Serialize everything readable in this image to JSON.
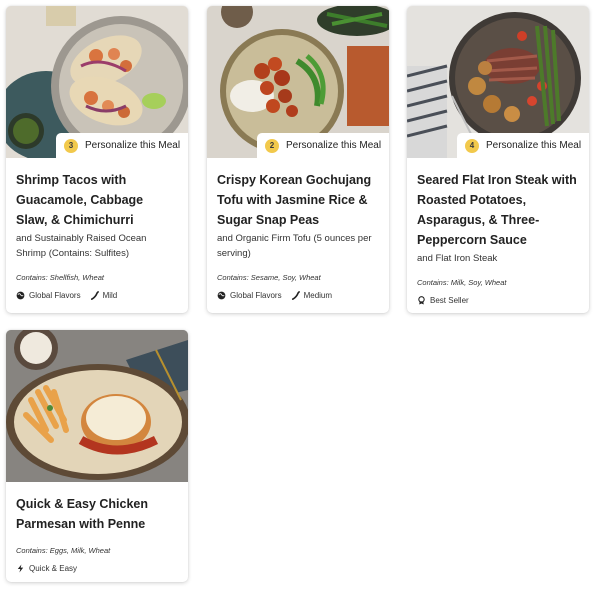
{
  "personalize_label": "Personalize this Meal",
  "cards": [
    {
      "badge": "3",
      "title": "Shrimp Tacos with Guacamole, Cabbage Slaw, & Chimichurri",
      "subtitle": "and Sustainably Raised Ocean Shrimp (Contains: Sulfites)",
      "contains": "Contains: Shellfish, Wheat",
      "tags": [
        {
          "icon": "globe-icon",
          "label": "Global Flavors"
        },
        {
          "icon": "chili-pepper-icon",
          "label": "Mild"
        }
      ]
    },
    {
      "badge": "2",
      "title": "Crispy Korean Gochujang Tofu with Jasmine Rice & Sugar Snap Peas",
      "subtitle": "and Organic Firm Tofu (5 ounces per serving)",
      "contains": "Contains: Sesame, Soy, Wheat",
      "tags": [
        {
          "icon": "globe-icon",
          "label": "Global Flavors"
        },
        {
          "icon": "chili-pepper-icon",
          "label": "Medium"
        }
      ]
    },
    {
      "badge": "4",
      "title": "Seared Flat Iron Steak with Roasted Potatoes, Asparagus, & Three-Peppercorn Sauce",
      "subtitle": "and Flat Iron Steak",
      "contains": "Contains: Milk, Soy, Wheat",
      "tags": [
        {
          "icon": "ribbon-icon",
          "label": "Best Seller"
        }
      ]
    },
    {
      "title": "Quick & Easy Chicken Parmesan with Penne",
      "contains": "Contains: Eggs, Milk, Wheat",
      "tags": [
        {
          "icon": "lightning-icon",
          "label": "Quick & Easy"
        }
      ]
    }
  ]
}
